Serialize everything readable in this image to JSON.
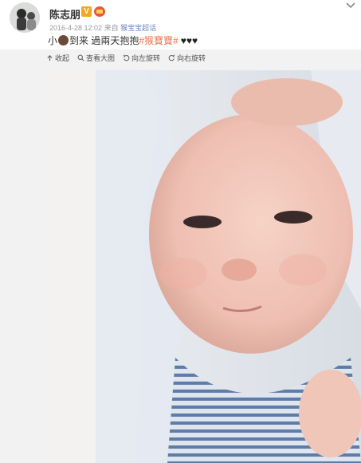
{
  "post": {
    "username": "陈志朋",
    "verified_badge": "V",
    "timestamp": "2016-4-28 12:02",
    "source_prefix": "来自",
    "source": "猴宝宝超话",
    "caption": {
      "part1": "小",
      "part2": "到来 過兩天抱抱",
      "tag": "#猴寶寶#",
      "hearts": "♥♥♥"
    }
  },
  "toolbar": {
    "collapse": "收起",
    "view_large": "查看大图",
    "rotate_left": "向左旋转",
    "rotate_right": "向右旋转"
  },
  "icons": {
    "collapse": "collapse-icon",
    "view_large": "magnify-icon",
    "rotate_left": "rotate-left-icon",
    "rotate_right": "rotate-right-icon",
    "more": "chevron-down-icon"
  },
  "colors": {
    "tag": "#eb7350",
    "source_link": "#6d8bb5",
    "verified": "#f5a623"
  }
}
